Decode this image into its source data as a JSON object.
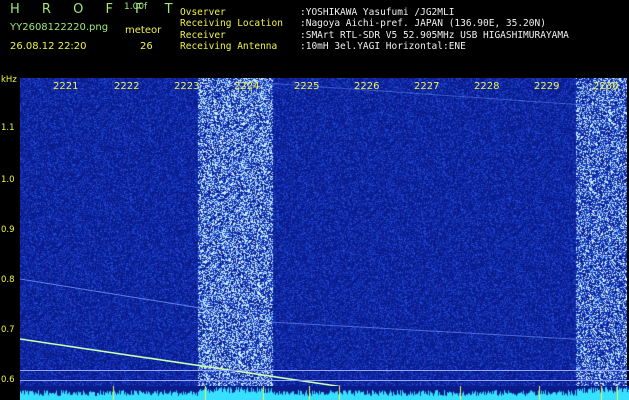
{
  "header": {
    "app_title": "H R O F F T",
    "version": "1.00f",
    "filename": "YY2608122220.png",
    "datetime": "26.08.12 22:20",
    "meteor_label": "meteor",
    "meteor_count": "26",
    "info": [
      {
        "key": "Ovserver",
        "value": ":YOSHIKAWA Yasufumi /JG2MLI"
      },
      {
        "key": "Receiving Location",
        "value": ":Nagoya Aichi-pref. JAPAN (136.90E, 35.20N)"
      },
      {
        "key": "Receiver",
        "value": ":SMArt RTL-SDR V5 52.905MHz USB HIGASHIMURAYAMA"
      },
      {
        "key": "Receiving Antenna",
        "value": ":10mH 3el.YAGI Horizontal:ENE"
      }
    ]
  },
  "axis": {
    "unit": "kHz",
    "freq_ticks": [
      "1.1",
      "1.0",
      "0.9",
      "0.8",
      "0.7",
      "0.6"
    ],
    "time_labels": [
      "2221",
      "2222",
      "2223",
      "2224",
      "2225",
      "2226",
      "2227",
      "2228",
      "2229",
      "2230"
    ]
  },
  "colors": {
    "background": "#0a1b8a",
    "label_green": "#9fe87a",
    "label_yellow": "#f2f24a",
    "signal": "#c8ffb0"
  }
}
